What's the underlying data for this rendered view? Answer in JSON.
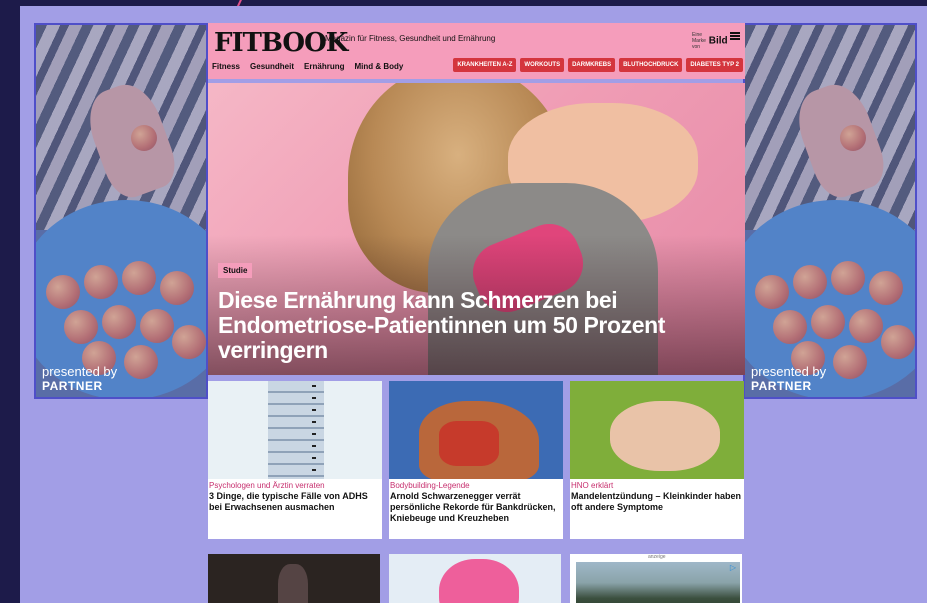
{
  "side_ads": {
    "left": {
      "presented_by": "presented by",
      "brand": "PARTNER"
    },
    "right": {
      "presented_by": "presented by",
      "brand": "PARTNER"
    }
  },
  "header": {
    "logo": "FITBOOK",
    "tagline": "Magazin für Fitness, Gesundheit und Ernährung",
    "partner_small": "Eine Marke von",
    "partner_brand": "Bild",
    "nav": [
      "Fitness",
      "Gesundheit",
      "Ernährung",
      "Mind & Body"
    ],
    "tags": [
      "KRANKHEITEN A-Z",
      "WORKOUTS",
      "DARMKREBS",
      "BLUTHOCHDRUCK",
      "DIABETES TYP 2"
    ]
  },
  "hero": {
    "label": "Studie",
    "title": "Diese Ernährung kann Schmerzen bei Endometriose-Patientinnen um 50 Prozent verringern"
  },
  "cards": [
    {
      "kicker": "Psychologen und Ärztin verraten",
      "title": "3 Dinge, die typische Fälle von ADHS bei Erwachsenen ausmachen"
    },
    {
      "kicker": "Bodybuilding-Legende",
      "title": "Arnold Schwarzenegger verrät persönliche Rekorde für Bankdrücken, Kniebeuge und Kreuzheben"
    },
    {
      "kicker": "HNO erklärt",
      "title": "Mandelentzündung – Kleinkinder haben oft andere Symptome"
    }
  ],
  "bottom_ad": {
    "label": "anzeige"
  }
}
